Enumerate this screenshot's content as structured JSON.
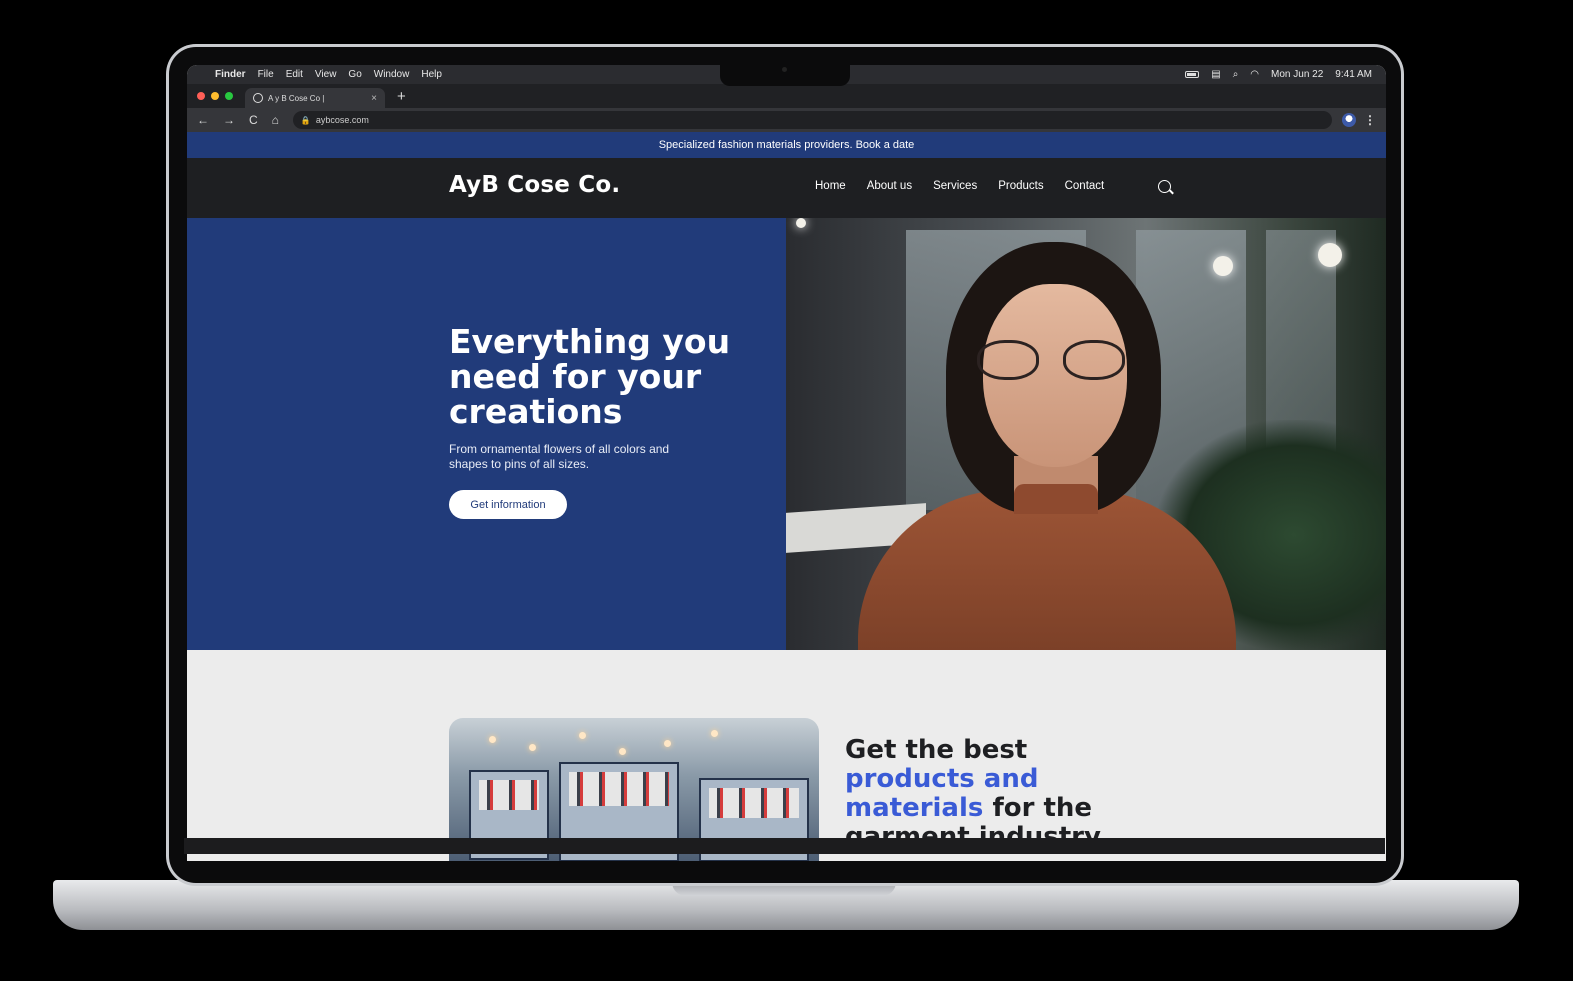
{
  "menubar": {
    "apple": "",
    "items": [
      "Finder",
      "File",
      "Edit",
      "View",
      "Go",
      "Window",
      "Help"
    ],
    "date": "Mon Jun 22",
    "time": "9:41 AM"
  },
  "browser": {
    "tab_title": "A y B Cose Co |",
    "tab_close": "×",
    "new_tab": "+",
    "url": "aybcose.com",
    "back": "←",
    "forward": "→",
    "reload": "C",
    "home": "⌂",
    "menu": "⋮",
    "traffic_colors": [
      "#ff5f57",
      "#febc2e",
      "#28c840"
    ]
  },
  "site": {
    "announcement": "Specialized fashion materials providers. Book a date",
    "logo": "AyB Cose Co.",
    "nav": [
      "Home",
      "About us",
      "Services",
      "Products",
      "Contact"
    ],
    "hero": {
      "title": "Everything you need for your creations",
      "subtitle": "From ornamental flowers of all colors and shapes to pins of all sizes.",
      "button": "Get information"
    },
    "feature": {
      "title_part1": "Get the best",
      "title_highlight": "products and materials",
      "title_part2": "for the garment industry"
    },
    "colors": {
      "brand_blue": "#213b7a",
      "accent_blue": "#3a5bd6",
      "header_dark": "#1e1f22"
    }
  }
}
